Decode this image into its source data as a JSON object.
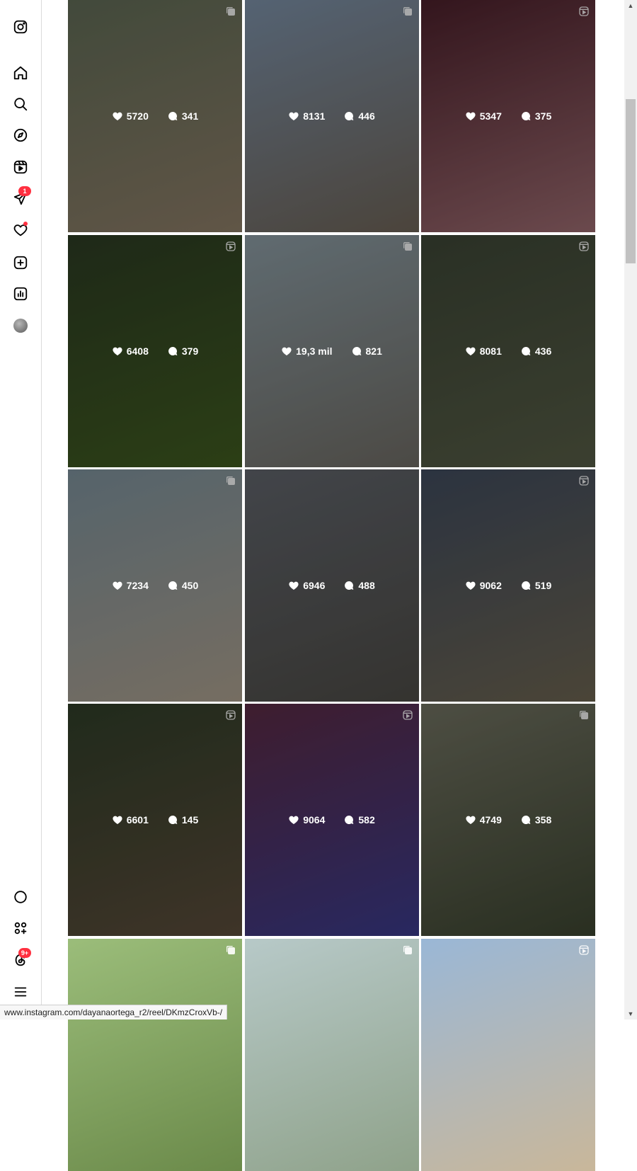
{
  "sidebar": {
    "items": [
      {
        "icon": "instagram-logo-icon",
        "badge": ""
      },
      {
        "icon": "home-icon",
        "badge": ""
      },
      {
        "icon": "search-icon",
        "badge": ""
      },
      {
        "icon": "explore-compass-icon",
        "badge": ""
      },
      {
        "icon": "reels-icon",
        "badge": ""
      },
      {
        "icon": "messages-icon",
        "badge": "1"
      },
      {
        "icon": "notifications-heart-icon",
        "badge": "dot"
      },
      {
        "icon": "create-plus-icon",
        "badge": ""
      },
      {
        "icon": "dashboard-icon",
        "badge": ""
      },
      {
        "icon": "profile-avatar",
        "badge": ""
      },
      {
        "icon": "meta-ai-icon",
        "badge": ""
      },
      {
        "icon": "also-from-meta-icon",
        "badge": ""
      },
      {
        "icon": "threads-icon",
        "badge": "9+"
      },
      {
        "icon": "more-menu-icon",
        "badge": ""
      }
    ]
  },
  "posts": [
    {
      "likes": "",
      "comments": "",
      "type": "none",
      "overlay": false,
      "colors": [
        "#6b6e76",
        "#3a3c44"
      ]
    },
    {
      "likes": "",
      "comments": "",
      "type": "none",
      "overlay": false,
      "colors": [
        "#1c1e3a",
        "#2c2f52"
      ]
    },
    {
      "likes": "",
      "comments": "",
      "type": "none",
      "overlay": false,
      "colors": [
        "#7a1c1c",
        "#b12a2a"
      ]
    },
    {
      "likes": "5720",
      "comments": "341",
      "type": "carousel",
      "overlay": true,
      "colors": [
        "#5f6a55",
        "#8b7b66"
      ]
    },
    {
      "likes": "8131",
      "comments": "446",
      "type": "carousel",
      "overlay": true,
      "colors": [
        "#7a8ea5",
        "#6c6256"
      ]
    },
    {
      "likes": "5347",
      "comments": "375",
      "type": "reel",
      "overlay": true,
      "colors": [
        "#4a1f2a",
        "#9a6a6f"
      ]
    },
    {
      "likes": "6408",
      "comments": "379",
      "type": "reel",
      "overlay": true,
      "colors": [
        "#2c3b23",
        "#3f5a1f"
      ]
    },
    {
      "likes": "19,3 mil",
      "comments": "821",
      "type": "carousel",
      "overlay": true,
      "colors": [
        "#8a9aa2",
        "#6d6a63"
      ]
    },
    {
      "likes": "8081",
      "comments": "436",
      "type": "reel",
      "overlay": true,
      "colors": [
        "#3c4535",
        "#555b45"
      ]
    },
    {
      "likes": "7234",
      "comments": "450",
      "type": "carousel",
      "overlay": true,
      "colors": [
        "#7b8f9a",
        "#a99d8c"
      ]
    },
    {
      "likes": "6946",
      "comments": "488",
      "type": "none",
      "overlay": true,
      "colors": [
        "#5f636a",
        "#4c4a45"
      ]
    },
    {
      "likes": "9062",
      "comments": "519",
      "type": "reel",
      "overlay": true,
      "colors": [
        "#3f4a5c",
        "#6b6350"
      ]
    },
    {
      "likes": "6601",
      "comments": "145",
      "type": "reel",
      "overlay": true,
      "colors": [
        "#2f3d28",
        "#5a4b3a"
      ]
    },
    {
      "likes": "9064",
      "comments": "582",
      "type": "reel",
      "overlay": true,
      "colors": [
        "#5a2a43",
        "#3a3a8a"
      ]
    },
    {
      "likes": "4749",
      "comments": "358",
      "type": "carousel",
      "overlay": true,
      "colors": [
        "#6f7060",
        "#3c4430"
      ]
    },
    {
      "likes": "",
      "comments": "",
      "type": "carousel",
      "overlay": false,
      "colors": [
        "#9bbd7a",
        "#6b8a4a"
      ]
    },
    {
      "likes": "",
      "comments": "",
      "type": "carousel",
      "overlay": false,
      "colors": [
        "#b7c9c8",
        "#8fa28a"
      ]
    },
    {
      "likes": "",
      "comments": "",
      "type": "reel",
      "overlay": false,
      "colors": [
        "#9ab7d6",
        "#c9b79a"
      ]
    }
  ],
  "status_url": "www.instagram.com/dayanaortega_r2/reel/DKmzCroxVb-/",
  "colors": {
    "badge": "#ff3040",
    "border": "#dbdbdb"
  }
}
